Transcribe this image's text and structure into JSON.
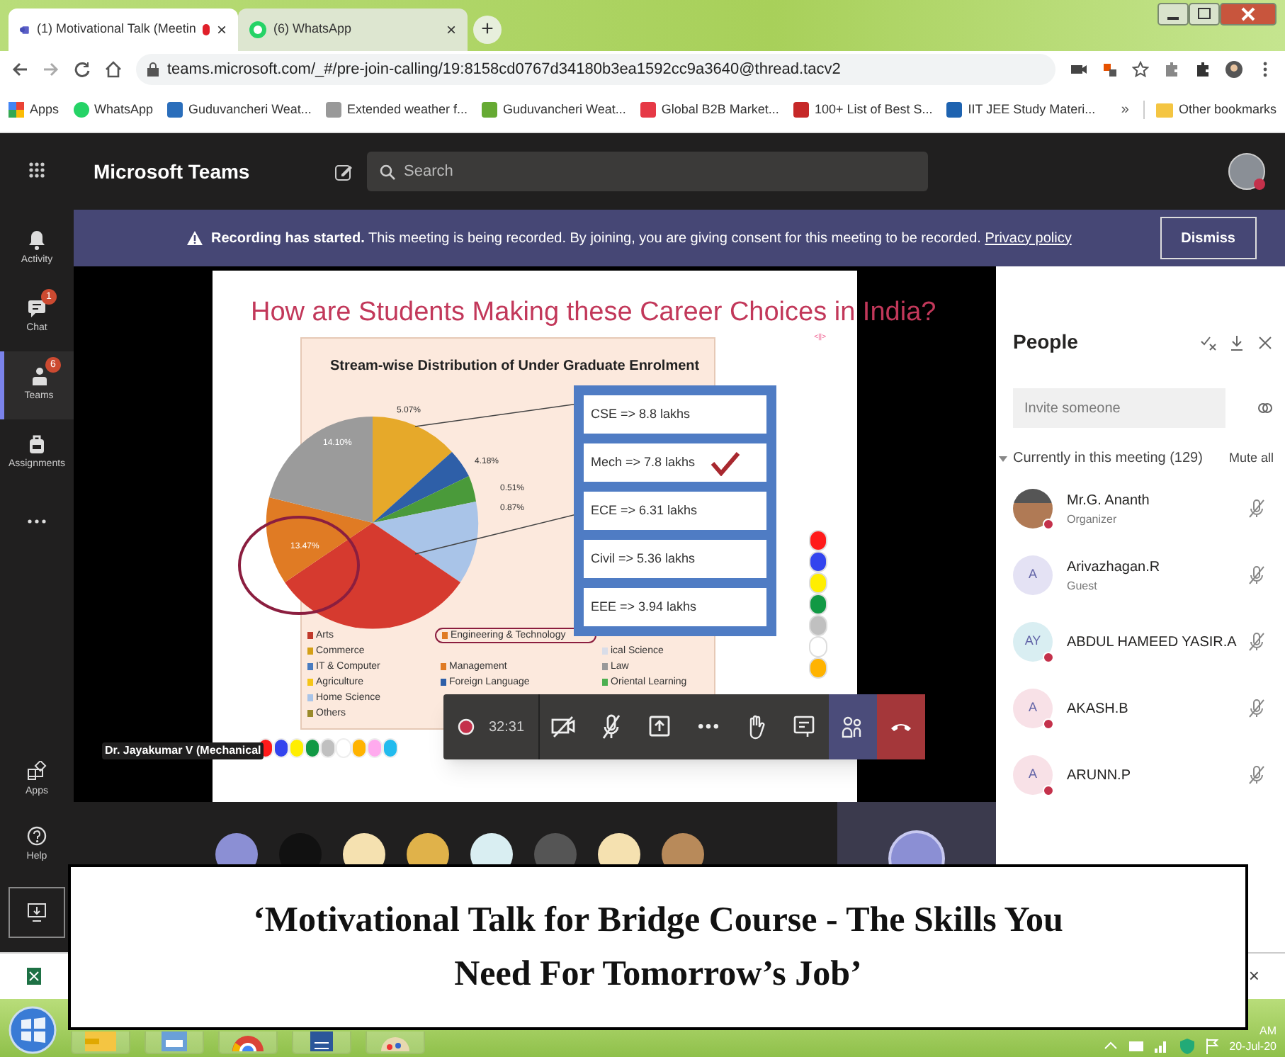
{
  "browser": {
    "tabs": [
      {
        "title": "(1) Motivational Talk (Meetin",
        "recording": true,
        "selected": true,
        "close": "×"
      },
      {
        "title": "(6) WhatsApp",
        "recording": false,
        "selected": false,
        "close": "×"
      }
    ],
    "new_tab": "+",
    "url": "teams.microsoft.com/_#/pre-join-calling/19:8158cd0767d34180b3ea1592cc9a3640@thread.tacv2",
    "bookmarks": [
      "Apps",
      "WhatsApp",
      "Guduvancheri Weat...",
      "Extended weather f...",
      "Guduvancheri Weat...",
      "Global B2B Market...",
      "100+ List of Best S...",
      "IIT JEE Study Materi..."
    ],
    "more_bookmarks": "»",
    "other_bookmarks": "Other bookmarks"
  },
  "teams": {
    "app_name": "Microsoft Teams",
    "search_placeholder": "Search",
    "rail": [
      {
        "label": "Activity",
        "selected": false,
        "kind": "bell"
      },
      {
        "label": "Chat",
        "badge": "1",
        "selected": false,
        "kind": "chat"
      },
      {
        "label": "Teams",
        "badge": "6",
        "selected": true,
        "kind": "teams"
      },
      {
        "label": "Assignments",
        "selected": false,
        "kind": "bag"
      },
      {
        "selected": false,
        "kind": "more"
      }
    ],
    "rail_bottom": [
      {
        "label": "Apps",
        "kind": "apps"
      },
      {
        "label": "Help",
        "kind": "help"
      }
    ],
    "banner": {
      "text": "**Recording has started.** This meeting is being recorded. By joining, you are giving consent for this meeting to be recorded.",
      "link": "Privacy policy",
      "button": "Dismiss"
    },
    "slide": {
      "title": "How are Students Making these Career Choices in India?",
      "corner_mark": "<||>",
      "chart_title": "Stream-wise Distribution of Under Graduate Enrolment",
      "pie_labels": [
        "5.07%",
        "4.18%",
        "14.10%",
        "13.47%",
        "0.51%",
        "0.87%"
      ],
      "legend": [
        {
          "label": "Arts",
          "color": "#c0392b"
        },
        {
          "label": "Commerce",
          "color": "#d4a017"
        },
        {
          "label": "IT & Computer",
          "color": "#4a7cc0"
        },
        {
          "label": "Agriculture",
          "color": "#f5c518"
        },
        {
          "label": "Home Science",
          "color": "#a9c4e8"
        },
        {
          "label": "Others",
          "color": "#9a8a2a"
        },
        {
          "label": "Engineering & Technology",
          "color": "#e07b24"
        },
        {
          "label": "Management",
          "color": "#e07b24"
        },
        {
          "label": "Foreign Language",
          "color": "#2e5fa8"
        },
        {
          "label": "ical Science",
          "color": "#d9dde8"
        },
        {
          "label": "Law",
          "color": "#999999"
        },
        {
          "label": "Oriental Learning",
          "color": "#4caf50"
        }
      ],
      "branches": [
        {
          "text": "CSE => 8.8 lakhs",
          "checked": false
        },
        {
          "text": "Mech => 7.8 lakhs",
          "checked": true
        },
        {
          "text": "ECE => 6.31 lakhs",
          "checked": false
        },
        {
          "text": "Civil => 5.36 lakhs",
          "checked": false
        },
        {
          "text": "EEE => 3.94 lakhs",
          "checked": false
        }
      ],
      "dot_column": [
        {
          "color": "#ff1a1a"
        },
        {
          "color": "#3344ee"
        },
        {
          "color": "#ffee00"
        },
        {
          "color": "#119944"
        },
        {
          "color": "#c0c0c0"
        },
        {
          "color": "#ffffff"
        },
        {
          "color": "#ffb300"
        }
      ],
      "dot_row": [
        {
          "color": "#ff1a1a"
        },
        {
          "color": "#3344ee"
        },
        {
          "color": "#ffee00"
        },
        {
          "color": "#119944"
        },
        {
          "color": "#c0c0c0"
        },
        {
          "color": "#ffffff"
        },
        {
          "color": "#ffb300"
        },
        {
          "color": "#ffaaee"
        },
        {
          "color": "#22bbee"
        }
      ]
    },
    "presenter": "Dr. Jayakumar V (Mechanical",
    "call_timer": "32:31",
    "people": {
      "title": "People",
      "invite_placeholder": "Invite someone",
      "section": "Currently in this meeting (129)",
      "section_expanded": true,
      "mute_all": "Mute all",
      "members": [
        {
          "name": "Mr.G. Ananth",
          "role": "Organizer",
          "kind": "photo",
          "color": "#cccccc",
          "status_dot": true
        },
        {
          "name": "Arivazhagan.R",
          "role": "Guest",
          "kind": "initials",
          "initials": "A",
          "color": "#e4e2f4",
          "status_dot": false
        },
        {
          "name": "ABDUL HAMEED YASIR.A",
          "kind": "initials",
          "initials": "AY",
          "color": "#d9eef2",
          "status_dot": true
        },
        {
          "name": "AKASH.B",
          "kind": "initials",
          "initials": "A",
          "color": "#f8e1e7",
          "status_dot": true
        },
        {
          "name": "ARUNN.P",
          "kind": "initials",
          "initials": "A",
          "color": "#f8e1e7",
          "status_dot": true
        }
      ]
    }
  },
  "download_bar": {
    "close": "×"
  },
  "taskbar": {
    "time": "AM",
    "date": "20-Jul-20"
  },
  "caption": {
    "line1": "‘Motivational Talk for Bridge Course - The Skills You",
    "line2": "Need For Tomorrow’s Job’"
  }
}
